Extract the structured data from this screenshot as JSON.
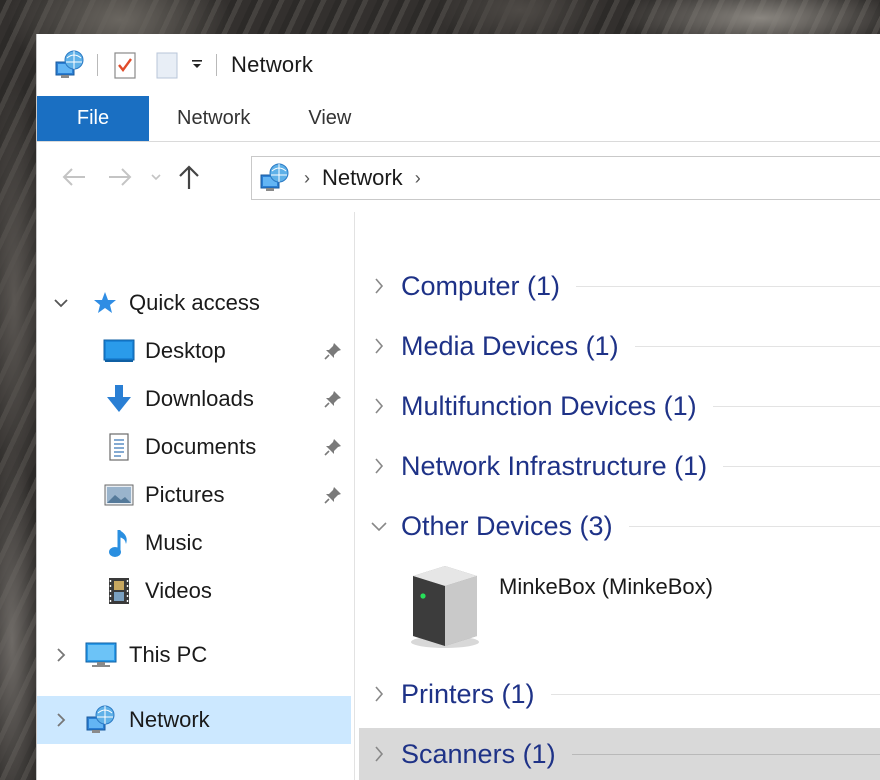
{
  "window": {
    "title": "Network"
  },
  "quick_access_toolbar": {
    "icons": [
      "network-icon",
      "properties-icon",
      "new-folder-icon",
      "customize-dropdown-icon"
    ]
  },
  "ribbon": {
    "tabs": [
      {
        "label": "File"
      },
      {
        "label": "Network"
      },
      {
        "label": "View"
      }
    ],
    "file_color": "#1a6fc2"
  },
  "navigation": {
    "back_icon": "back-arrow-icon",
    "forward_icon": "forward-arrow-icon",
    "recent_icon": "recent-locations-chevron-icon",
    "up_icon": "up-arrow-icon"
  },
  "address_bar": {
    "segments": [
      "Network"
    ]
  },
  "sidebar": {
    "quick_access": {
      "label": "Quick access",
      "expanded": true
    },
    "items": [
      {
        "label": "Desktop",
        "icon": "desktop-icon",
        "pinned": true
      },
      {
        "label": "Downloads",
        "icon": "downloads-icon",
        "pinned": true
      },
      {
        "label": "Documents",
        "icon": "documents-icon",
        "pinned": true
      },
      {
        "label": "Pictures",
        "icon": "pictures-icon",
        "pinned": true
      },
      {
        "label": "Music",
        "icon": "music-icon",
        "pinned": false
      },
      {
        "label": "Videos",
        "icon": "videos-icon",
        "pinned": false
      }
    ],
    "this_pc": {
      "label": "This PC"
    },
    "network": {
      "label": "Network",
      "selected": true
    },
    "selected_color": "#cce8ff"
  },
  "content": {
    "groups": [
      {
        "label": "Computer (1)",
        "expanded": false
      },
      {
        "label": "Media Devices (1)",
        "expanded": false
      },
      {
        "label": "Multifunction Devices (1)",
        "expanded": false
      },
      {
        "label": "Network Infrastructure (1)",
        "expanded": false
      },
      {
        "label": "Other Devices (3)",
        "expanded": true
      },
      {
        "label": "Printers (1)",
        "expanded": false
      },
      {
        "label": "Scanners (1)",
        "expanded": false,
        "hovered": true
      }
    ],
    "device": {
      "label": "MinkeBox (MinkeBox)",
      "icon": "server-icon"
    },
    "group_header_color": "#1e3287"
  }
}
